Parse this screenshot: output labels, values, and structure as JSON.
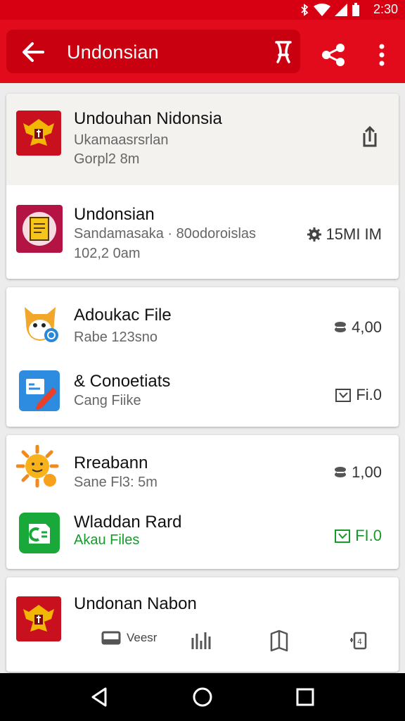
{
  "status_bar": {
    "time": "2:30",
    "icons": [
      "bluetooth-icon",
      "wifi-icon",
      "signal-icon",
      "battery-icon"
    ]
  },
  "app_bar": {
    "title": "Undonsian"
  },
  "cards": [
    {
      "rows": [
        {
          "title": "Undouhan Nidonsia",
          "subtitle": "Ukamaasrsrlan",
          "subtitle2": "Gorpl2 8m",
          "icon": "garuda-emblem-icon",
          "action": "share-export-icon",
          "highlighted": true
        },
        {
          "title": "Undonsian",
          "subtitle": "Sandamasaka · 80odoroislas",
          "subtitle2": "102,2 0am",
          "icon": "document-app-icon",
          "meta": "15MI IM",
          "meta_icon": "gear-icon"
        }
      ]
    },
    {
      "rows": [
        {
          "title": "Adoukac File",
          "subtitle": "Rabe 123sno",
          "icon": "mascot-app-icon",
          "meta": "4,00",
          "meta_icon": "coin-icon"
        },
        {
          "title": "& Conoetiats",
          "subtitle": "Cang Fiike",
          "icon": "edit-app-icon",
          "meta": "Fi.0",
          "meta_icon": "checkbox-icon"
        }
      ]
    },
    {
      "rows": [
        {
          "title": "Rreabann",
          "subtitle": "Sane Fl3: 5m",
          "icon": "sun-app-icon",
          "meta": "1,00",
          "meta_icon": "coin-icon"
        },
        {
          "title": "Wladdan Rard",
          "subtitle": "Akau Files",
          "icon": "files-app-icon",
          "meta": "FI.0",
          "meta_icon": "checkbox-icon",
          "green": true
        }
      ]
    },
    {
      "rows": [
        {
          "title": "Undonan Nabon",
          "icon": "garuda-emblem-icon"
        }
      ]
    }
  ],
  "bottom_bar": {
    "item1_label": "Veesr"
  },
  "colors": {
    "brand_red": "#e10b1c",
    "dark_red": "#c80010",
    "accent_green": "#169a2c"
  }
}
